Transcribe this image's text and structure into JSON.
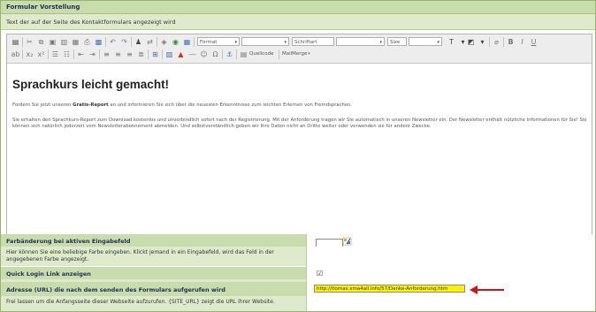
{
  "section": {
    "title": "Formular Vorstellung",
    "description": "Text der auf der Seite des Kontaktformulars angezeigt wird"
  },
  "editor": {
    "toolbar": {
      "format_label": "Format",
      "font_label": "Schriftart",
      "size_label": "Size",
      "source_label": "Quellcode",
      "mailmerge_label": "MailMerge"
    },
    "headline": "Sprachkurs leicht gemacht!",
    "paragraph1_pre": "Fordern Sie jetzt unseren ",
    "paragraph1_bold": "Gratis-Report",
    "paragraph1_post": " an und informieren Sie sich über die neuesten Erkenntnisse zum leichten Erlernen von Fremdsprachen.",
    "paragraph2": "Sie erhalten den Sprachkurs-Report zum Download kostenlos und unverbindlich sofort nach der Registrierung. Mit der Anforderung tragen wir Sie automatisch in unseren Newsletter ein. Der Newsletter enthält nützliche Informationen für Sie! Sie können sich natürlich jederzeit vom Newsletterabonnement abmelden. Und selbstverständlich geben wir Ihre Daten nicht an Dritte weiter oder verwenden sie für andere Zwecke."
  },
  "settings": {
    "color_change": {
      "title": "Farbänderung bei aktiven Eingabefeld",
      "description": "Hier können Sie eine beliebige Farbe eingeben. Klickt jemand in ein Eingabefeld, wird das Feld in der angegebenen Farbe angezeigt.",
      "value": ""
    },
    "quick_login": {
      "title": "Quick Login Link anzeigen",
      "checked_glyph": "☑"
    },
    "redirect_url": {
      "title": "Adresse (URL) die nach dem senden des Formulars aufgerufen wird",
      "description": "Frei lassen um die Anfangsseite dieser Webseite aufzurufen. {SITE_URL} zeigt die URL ihrer Website.",
      "value": "http://itomas.xma4all.info/57/Danke-Anforderung.htm"
    }
  },
  "colors": {
    "header_green": "#c9dcad",
    "light_green": "#dfeacc",
    "highlight_yellow": "#fff200",
    "arrow_red": "#d0121b"
  }
}
